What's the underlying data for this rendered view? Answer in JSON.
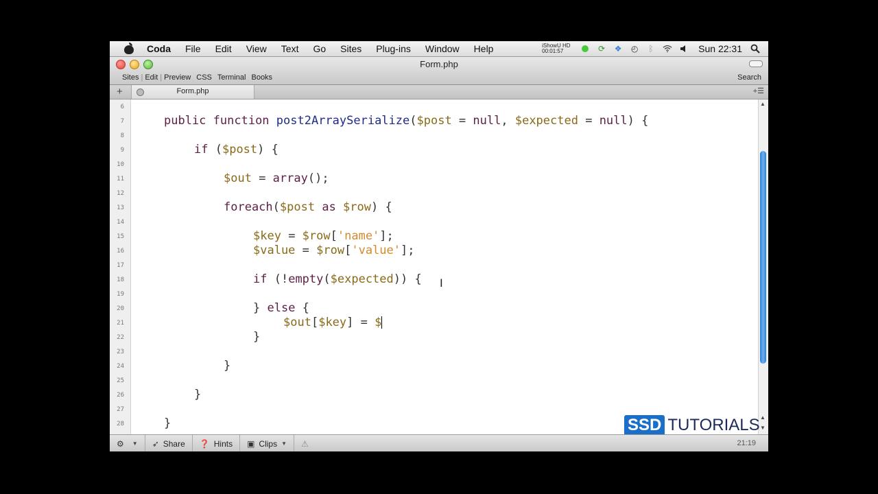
{
  "menubar": {
    "app_name": "Coda",
    "items": [
      "File",
      "Edit",
      "View",
      "Text",
      "Go",
      "Sites",
      "Plug-ins",
      "Window",
      "Help"
    ],
    "ishowu_line1": "iShowU HD",
    "ishowu_line2": "00:01:57",
    "clock": "Sun 22:31"
  },
  "window": {
    "title": "Form.php",
    "toolbar": [
      "Sites",
      "Edit",
      "Preview",
      "CSS",
      "Terminal",
      "Books"
    ],
    "search_label": "Search"
  },
  "tab": {
    "label": "Form.php"
  },
  "editor": {
    "line_numbers": [
      "6",
      "7",
      "8",
      "9",
      "10",
      "11",
      "12",
      "13",
      "14",
      "15",
      "16",
      "17",
      "18",
      "19",
      "20",
      "21",
      "22",
      "23",
      "24",
      "25",
      "26",
      "27",
      "28"
    ]
  },
  "watermark": {
    "box": "SSD",
    "text": "TUTORIALS"
  },
  "statusbar": {
    "share": "Share",
    "hints": "Hints",
    "clips": "Clips",
    "position": "21:19"
  }
}
